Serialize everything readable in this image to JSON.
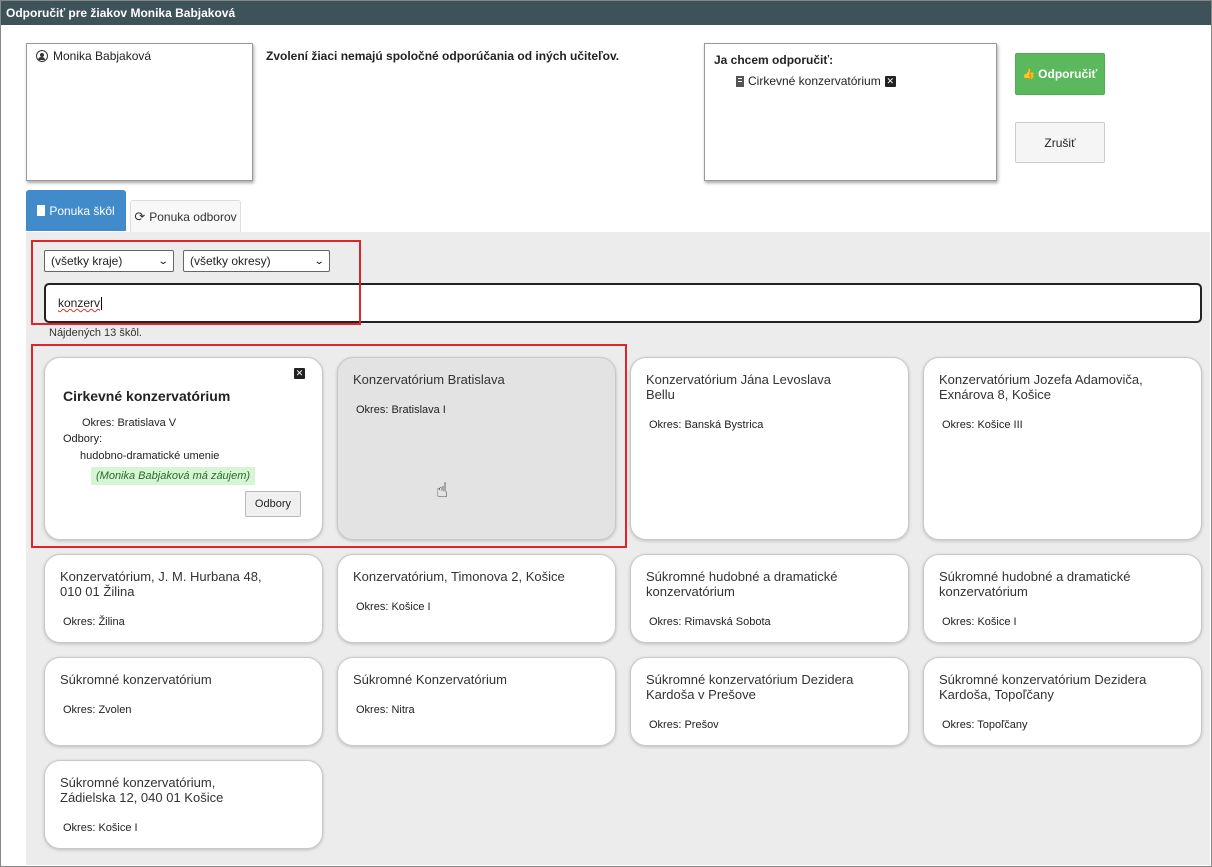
{
  "window": {
    "title": "Odporučiť pre žiakov Monika Babjaková"
  },
  "students": {
    "items": [
      {
        "name": "Monika Babjaková",
        "icon": "user-icon"
      }
    ]
  },
  "notice": "Zvolení žiaci nemajú spoločné odporúčania od iných učiteľov.",
  "recommend": {
    "title": "Ja chcem odporučiť:",
    "items": [
      {
        "label": "Cirkevné konzervatórium",
        "icon": "building-icon"
      }
    ]
  },
  "buttons": {
    "recommend_label": "Odporučiť",
    "cancel_label": "Zrušiť"
  },
  "tabs": [
    {
      "label": "Ponuka škôl",
      "icon": "building-icon",
      "active": true
    },
    {
      "label": "Ponuka odborov",
      "icon": "refresh-icon",
      "active": false
    }
  ],
  "filters": {
    "region": {
      "value": "(všetky kraje)"
    },
    "district": {
      "value": "(všetky okresy)"
    },
    "search": {
      "value": "konzerv"
    }
  },
  "results_count": "Nájdených 13 škôl.",
  "selected_card": {
    "title": "Cirkevné konzervatórium",
    "district": "Okres: Bratislava V",
    "fields_label": "Odbory:",
    "field": "hudobno-dramatické umenie",
    "interest": "(Monika Babjaková má záujem)",
    "fields_button": "Odbory"
  },
  "schools": [
    {
      "name": "Konzervatórium Bratislava",
      "district": "Okres: Bratislava I"
    },
    {
      "name": "Konzervatórium Jána Levoslava Bellu",
      "district": "Okres: Banská Bystrica"
    },
    {
      "name": "Konzervatórium Jozefa Adamoviča, Exnárova 8, Košice",
      "district": "Okres: Košice III"
    },
    {
      "name": "Konzervatórium, J. M. Hurbana 48, 010 01 Žilina",
      "district": "Okres: Žilina"
    },
    {
      "name": "Konzervatórium, Timonova 2, Košice",
      "district": "Okres: Košice I"
    },
    {
      "name": "Súkromné hudobné a dramatické konzervatórium",
      "district": "Okres: Rimavská Sobota"
    },
    {
      "name": "Súkromné hudobné a dramatické konzervatórium",
      "district": "Okres: Košice I"
    },
    {
      "name": "Súkromné konzervatórium",
      "district": "Okres: Zvolen"
    },
    {
      "name": "Súkromné Konzervatórium",
      "district": "Okres: Nitra"
    },
    {
      "name": "Súkromné konzervatórium Dezidera Kardoša v Prešove",
      "district": "Okres: Prešov"
    },
    {
      "name": "Súkromné konzervatórium Dezidera Kardoša, Topoľčany",
      "district": "Okres: Topoľčany"
    },
    {
      "name": "Súkromné konzervatórium, Zádielska 12, 040 01 Košice",
      "district": "Okres: Košice I"
    }
  ],
  "colors": {
    "titlebar": "#3d5359",
    "active_tab": "#428bca",
    "recommend": "#5cb85c",
    "highlight": "#e0242b",
    "interest_bg": "#d5f5d5"
  }
}
